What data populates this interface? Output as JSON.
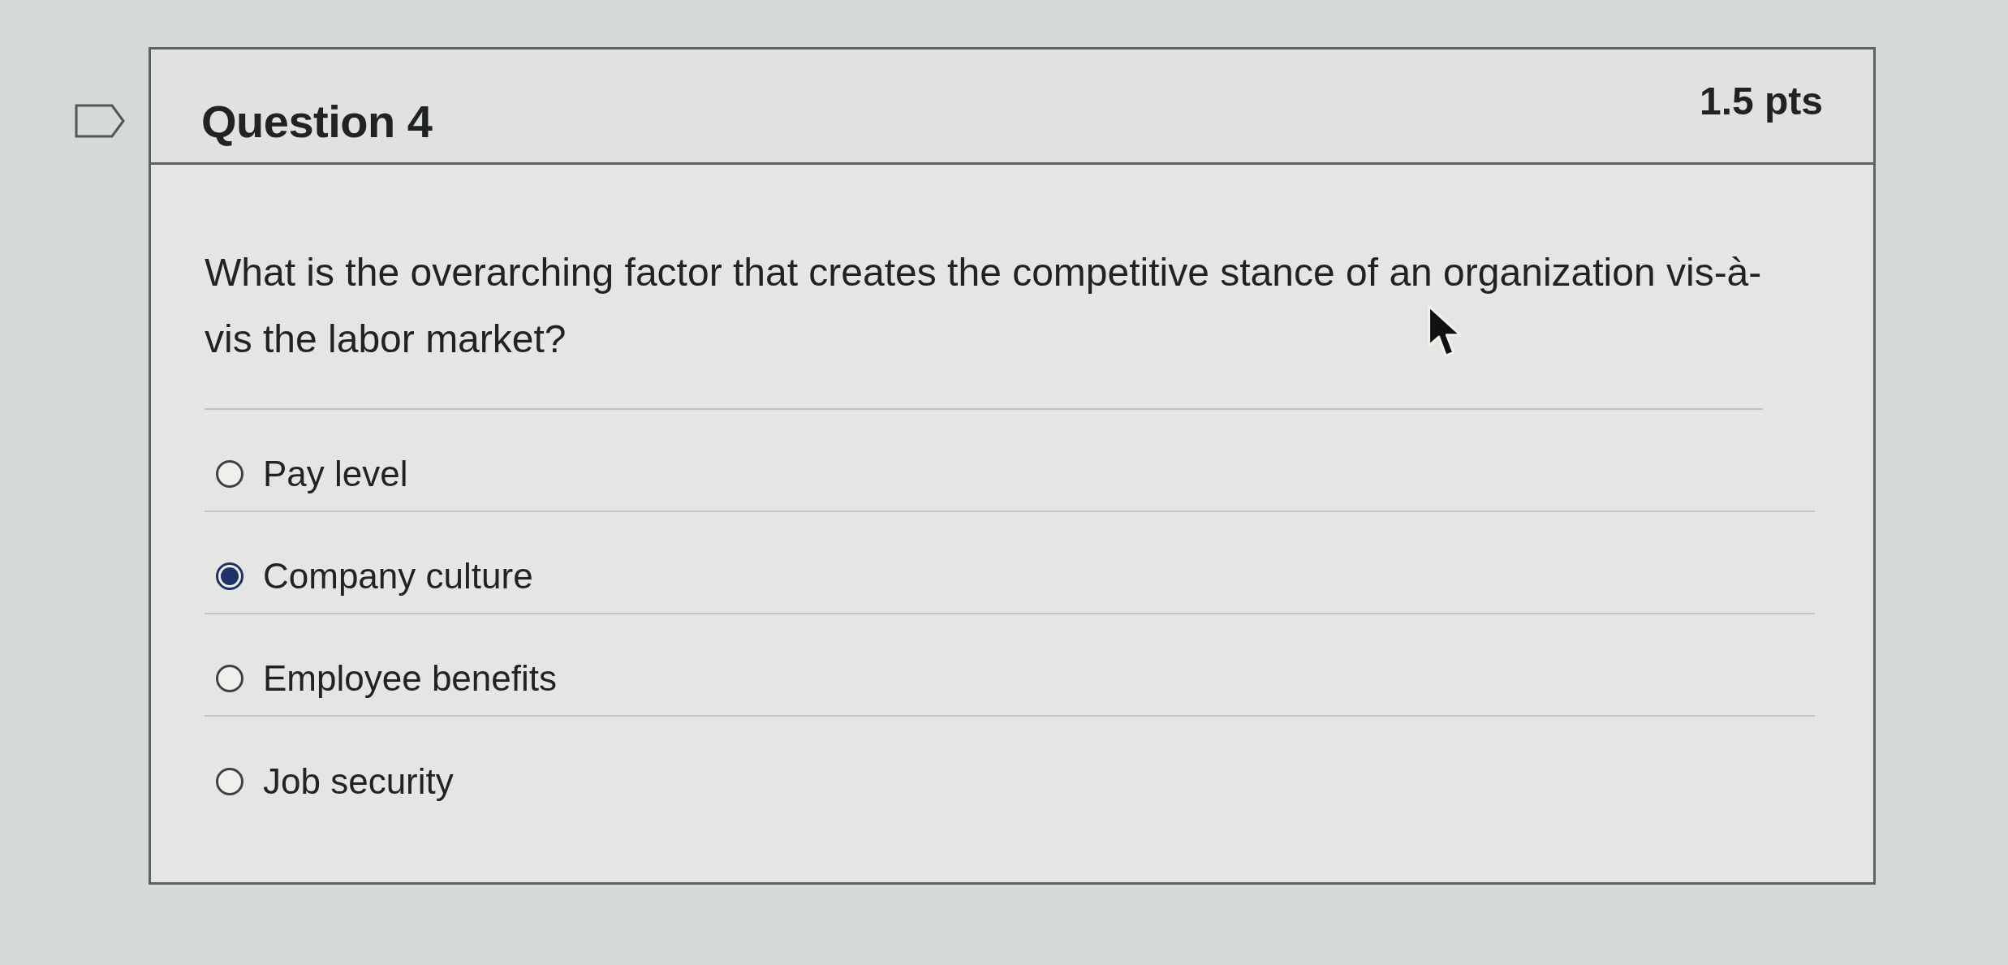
{
  "question": {
    "flagged": false,
    "title": "Question 4",
    "points": "1.5 pts",
    "text": "What is the overarching factor that creates the competitive stance of an organization vis-à-vis the labor market?"
  },
  "answers": [
    {
      "label": "Pay level",
      "selected": false
    },
    {
      "label": "Company culture",
      "selected": true
    },
    {
      "label": "Employee benefits",
      "selected": false
    },
    {
      "label": "Job security",
      "selected": false
    }
  ]
}
